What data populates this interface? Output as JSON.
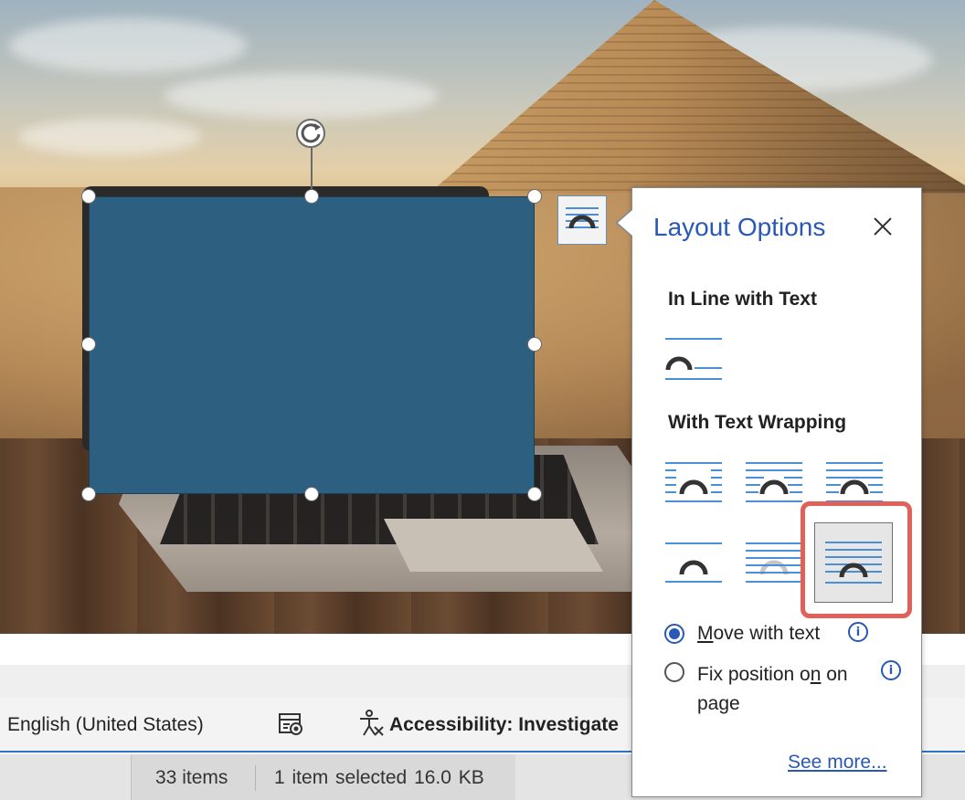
{
  "layout_options": {
    "title": "Layout Options",
    "close_icon": "close-icon",
    "inline_section": "In Line with Text",
    "wrapping_section": "With Text Wrapping",
    "wrap_options": [
      {
        "id": "in-line-with-text",
        "selected": false
      },
      {
        "id": "square",
        "selected": false
      },
      {
        "id": "tight",
        "selected": false
      },
      {
        "id": "through",
        "selected": false
      },
      {
        "id": "top-and-bottom",
        "selected": false
      },
      {
        "id": "behind-text",
        "selected": false
      },
      {
        "id": "in-front-of-text",
        "selected": true
      }
    ],
    "move_with_text": {
      "label_prefix": "",
      "label_underlined": "M",
      "label_rest": "ove with text",
      "checked": true
    },
    "fix_position": {
      "label_line1_a": "Fix position o",
      "label_line1_u": "n",
      "label_line1_b": "",
      "label_line2": "page",
      "checked": false
    },
    "info_glyph": "i",
    "see_more": "See more..."
  },
  "status_bar": {
    "language": "English (United States)",
    "accessibility": "Accessibility: Investigate"
  },
  "explorer_bar": {
    "items_count": "33 items",
    "selected_info": "1 item selected  16.0 KB"
  },
  "colors": {
    "accent": "#2a58b5",
    "shape_fill": "#2c5f80",
    "highlight": "#e0615a",
    "wrap_line": "#4a8fd6",
    "wrap_arch": "#333333"
  }
}
